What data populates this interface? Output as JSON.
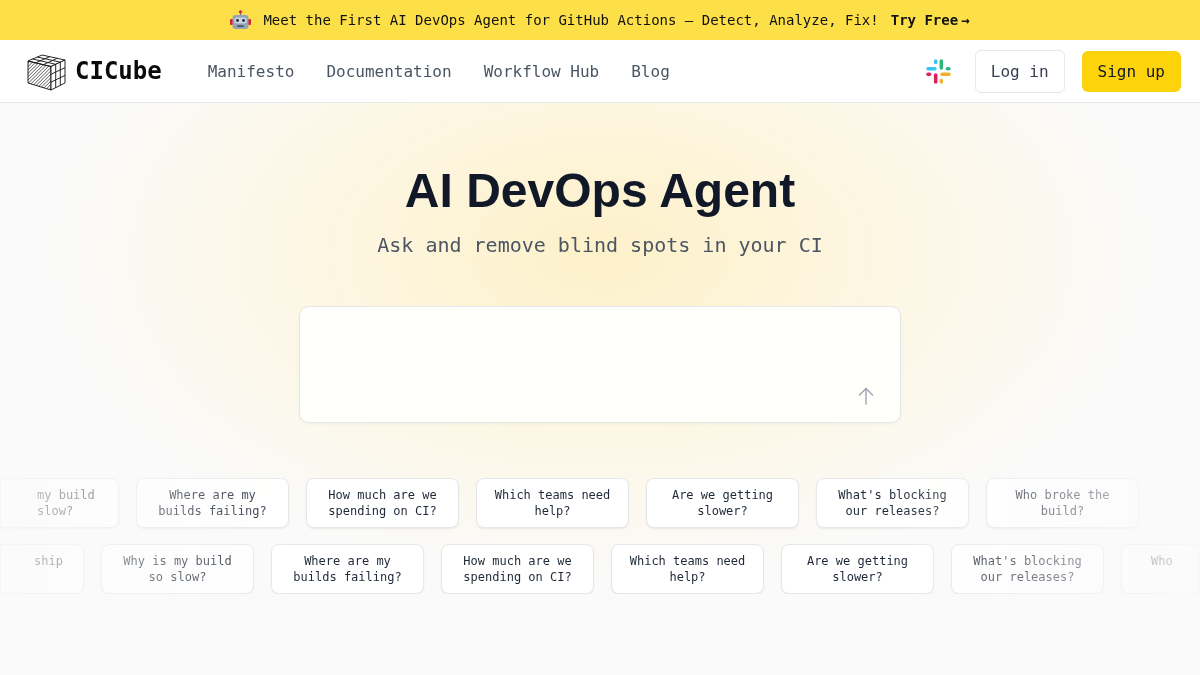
{
  "banner": {
    "text": "Meet the First AI DevOps Agent for GitHub Actions — Detect, Analyze, Fix!",
    "cta": "Try Free",
    "cta_arrow": "→"
  },
  "nav": {
    "logo": "CICube",
    "links": [
      "Manifesto",
      "Documentation",
      "Workflow Hub",
      "Blog"
    ],
    "buttons": [
      {
        "label": "Log in",
        "kind": "outline"
      },
      {
        "label": "Sign up",
        "kind": "primary"
      }
    ]
  },
  "hero": {
    "title": "AI DevOps Agent",
    "subtitle": "Ask and remove blind spots in your CI"
  },
  "suggestions": [
    [
      {
        "text": "my build slow?",
        "kind": "leftcut"
      },
      {
        "text": "Where are my builds failing?",
        "kind": "whole"
      },
      {
        "text": "How much are we spending on CI?",
        "kind": "whole"
      },
      {
        "text": "Which teams need help?",
        "kind": "whole"
      },
      {
        "text": "Are we getting slower?",
        "kind": "whole"
      },
      {
        "text": "What's blocking our releases?",
        "kind": "whole"
      },
      {
        "text": "Who broke the build?",
        "kind": "whole"
      }
    ],
    [
      {
        "text": "ship",
        "kind": "leftcut"
      },
      {
        "text": "Why is my build so slow?",
        "kind": "whole"
      },
      {
        "text": "Where are my builds failing?",
        "kind": "whole"
      },
      {
        "text": "How much are we spending on CI?",
        "kind": "whole"
      },
      {
        "text": "Which teams need help?",
        "kind": "whole"
      },
      {
        "text": "Are we getting slower?",
        "kind": "whole"
      },
      {
        "text": "What's blocking our releases?",
        "kind": "whole"
      },
      {
        "text": "Who",
        "kind": "rightcut"
      }
    ]
  ]
}
